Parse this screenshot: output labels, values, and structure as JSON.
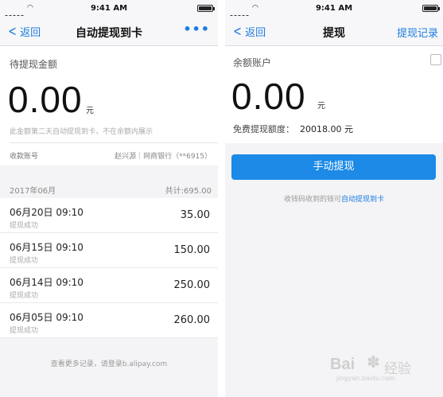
{
  "status_bar": {
    "time": "9:41 AM"
  },
  "left": {
    "nav": {
      "back_label": "返回",
      "title": "自动提现到卡",
      "more_label": "•••"
    },
    "pending_label": "待提现金额",
    "amount": "0.00",
    "unit": "元",
    "hint": "此金额第二天自动提现到卡，不在余额内展示",
    "account_label": "收款账号",
    "account_value": "赵兴源｜网商银行（**6915）",
    "month": "2017年06月",
    "total": "共计:695.00",
    "records": [
      {
        "date": "06月20日 09:10",
        "status": "提现成功",
        "amount": "35.00"
      },
      {
        "date": "06月15日 09:10",
        "status": "提现成功",
        "amount": "150.00"
      },
      {
        "date": "06月14日 09:10",
        "status": "提现成功",
        "amount": "250.00"
      },
      {
        "date": "06月05日 09:10",
        "status": "提现成功",
        "amount": "260.00"
      }
    ],
    "footer_hint": "查看更多记录，请登录b.alipay.com"
  },
  "right": {
    "nav": {
      "back_label": "返回",
      "title": "提现",
      "record_label": "提现记录"
    },
    "balance_label": "余额账户",
    "amount": "0.00",
    "unit": "元",
    "free_label": "免费提现额度：",
    "free_value": "20018.00 元",
    "button_label": "手动提现",
    "hint_prefix": "收钱码收到的钱可",
    "hint_link": "自动提现到卡"
  },
  "watermark": {
    "logo": "Bai",
    "name": "经验",
    "url": "jingyan.baidu.com"
  },
  "colors": {
    "accent": "#1c7ce0",
    "button": "#1c8ae6"
  }
}
